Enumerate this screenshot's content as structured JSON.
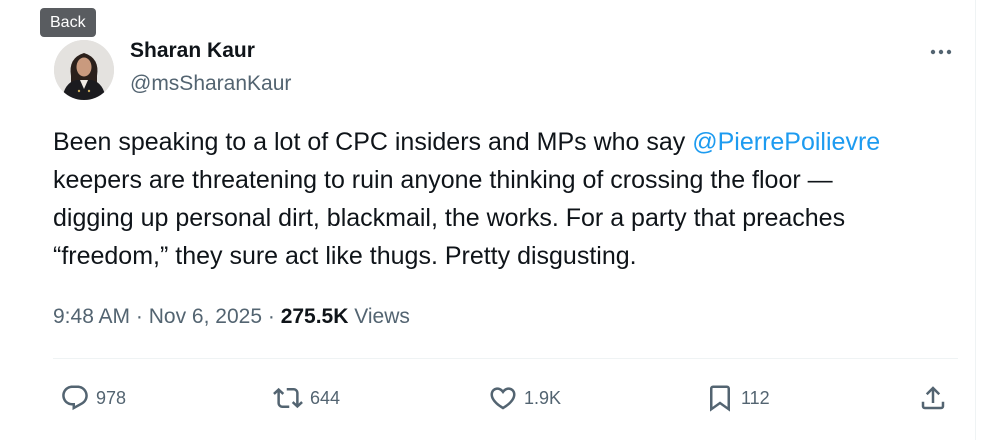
{
  "tooltip": {
    "label": "Back"
  },
  "author": {
    "name": "Sharan Kaur",
    "handle": "@msSharanKaur"
  },
  "tweet": {
    "lines": [
      [
        "Been speaking to a lot of CPC insiders and MPs who say ",
        "@PierrePoilievre"
      ],
      [
        "keepers are threatening to ruin anyone thinking of crossing the floor —"
      ],
      [
        "digging up personal dirt, blackmail, the works. For a party that preaches"
      ],
      [
        "“freedom,” they sure act like thugs. Pretty disgusting."
      ]
    ]
  },
  "meta": {
    "time": "9:48 AM",
    "separator": "·",
    "date": "Nov 6, 2025",
    "views_count": "275.5K",
    "views_label": "Views"
  },
  "actions": {
    "replies": "978",
    "reposts": "644",
    "likes": "1.9K",
    "bookmarks": "112"
  },
  "icons": {
    "more": "more-horizontal-icon",
    "reply": "reply-icon",
    "repost": "repost-icon",
    "like": "heart-icon",
    "bookmark": "bookmark-icon",
    "share": "share-icon"
  },
  "colors": {
    "text": "#0f1419",
    "secondary": "#536471",
    "link": "#1d9bf0",
    "divider": "#eff3f4",
    "tooltip": "#595c60"
  }
}
